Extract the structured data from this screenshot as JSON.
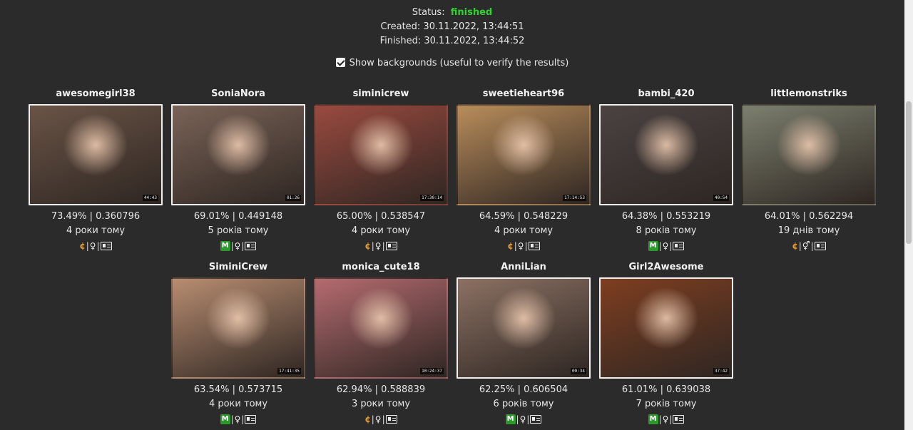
{
  "status": {
    "label": "Status:",
    "value": "finished",
    "created": "Created: 30.11.2022, 13:44:51",
    "finished": "Finished: 30.11.2022, 13:44:52"
  },
  "backgrounds_toggle": {
    "label": "Show backgrounds (useful to verify the results)",
    "checked": true
  },
  "colors": {
    "status_ok": "#2fd12f",
    "platform_m": "#2b9a2b",
    "platform_c": "#e89a2a"
  },
  "results": [
    {
      "name": "awesomegirl38",
      "score": "73.49% | 0.360796",
      "ago": "4 роки тому",
      "platform": "c",
      "gender": "♀",
      "duration": "44:43",
      "bg": "#6a5446",
      "border": true
    },
    {
      "name": "SoniaNora",
      "score": "69.01% | 0.449148",
      "ago": "5 років тому",
      "platform": "M",
      "gender": "♀",
      "duration": "01:26",
      "bg": "#7a6357",
      "border": true
    },
    {
      "name": "siminicrew",
      "score": "65.00% | 0.538547",
      "ago": "4 роки тому",
      "platform": "c",
      "gender": "♀",
      "duration": "17:30:14",
      "bg": "#9a4a3f",
      "border": false
    },
    {
      "name": "sweetieheart96",
      "score": "64.59% | 0.548229",
      "ago": "4 роки тому",
      "platform": "c",
      "gender": "♀",
      "duration": "17:14:53",
      "bg": "#b98d5b",
      "border": false
    },
    {
      "name": "bambi_420",
      "score": "64.38% | 0.553219",
      "ago": "8 років тому",
      "platform": "M",
      "gender": "♀",
      "duration": "40:54",
      "bg": "#4b4342",
      "border": true
    },
    {
      "name": "littlemonstriks",
      "score": "64.01% | 0.562294",
      "ago": "19 днів тому",
      "platform": "c",
      "gender": "⚥",
      "duration": "",
      "bg": "#7c7f6e",
      "border": false
    },
    {
      "name": "SiminiCrew",
      "score": "63.54% | 0.573715",
      "ago": "4 роки тому",
      "platform": "M",
      "gender": "♀",
      "duration": "17:41:35",
      "bg": "#b88d71",
      "border": false
    },
    {
      "name": "monica_cute18",
      "score": "62.94% | 0.588839",
      "ago": "3 роки тому",
      "platform": "c",
      "gender": "♀",
      "duration": "10:24:37",
      "bg": "#b56b70",
      "border": false
    },
    {
      "name": "AnniLian",
      "score": "62.25% | 0.606504",
      "ago": "6 років тому",
      "platform": "M",
      "gender": "♀",
      "duration": "09:34",
      "bg": "#8b7163",
      "border": true
    },
    {
      "name": "Girl2Awesome",
      "score": "61.01% | 0.639038",
      "ago": "7 років тому",
      "platform": "M",
      "gender": "♀",
      "duration": "37:42",
      "bg": "#7e3e20",
      "border": true
    }
  ]
}
